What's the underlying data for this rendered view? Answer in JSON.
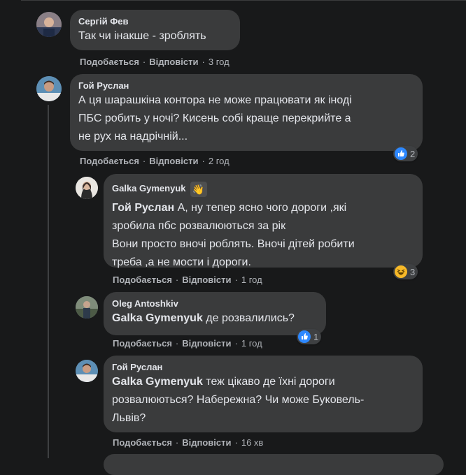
{
  "actions": {
    "like": "Подобається",
    "reply": "Відповісти"
  },
  "comments": [
    {
      "author": "Сергій Фев",
      "text": "Так чи інакше - зроблять",
      "time": "3 год"
    },
    {
      "author": "Гой Руслан",
      "text": "А ця шарашкіна контора не може працювати як іноді\nПБС робить у ночі? Кисень собі краще перекрийте а\nне рух на надрічній...",
      "time": "2 год",
      "reaction_count": "2",
      "reaction_type": "like"
    },
    {
      "author": "Galka Gymenyuk",
      "mention": "Гой Руслан",
      "text_line1": " А, ну тепер ясно чого дороги ,які",
      "text_rest": "зробила пбс розвалюються за рік\nВони просто вночі роблять. Вночі дітей робити\nтреба ,а не мости і дороги.",
      "time": "1 год",
      "reaction_count": "3",
      "reaction_type": "haha",
      "badge": "wave"
    },
    {
      "author": "Oleg Antoshkiv",
      "mention": "Galka Gymenyuk",
      "text_line1": " де розвалились?",
      "time": "1 год",
      "reaction_count": "1",
      "reaction_type": "like"
    },
    {
      "author": "Гой Руслан",
      "mention": "Galka Gymenyuk",
      "text_line1": " теж цікаво де їхні дороги",
      "text_rest": "розвалюються? Набережна? Чи може Буковель-\nЛьвів?",
      "time": "16 хв"
    }
  ],
  "colors": {
    "bg": "#18191a",
    "bubble": "#3a3b3c",
    "secondary": "#b0b3b8",
    "like_blue": "#2d88ff",
    "haha_yellow": "#f7b928"
  }
}
